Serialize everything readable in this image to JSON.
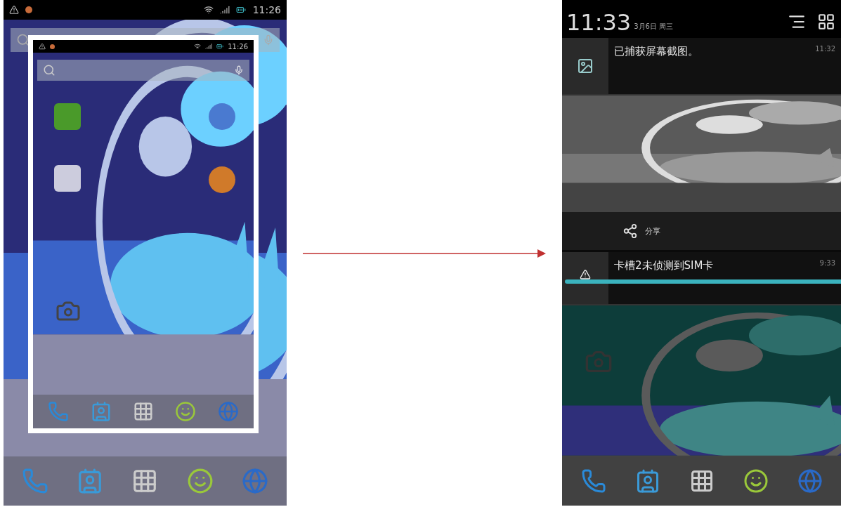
{
  "left_screen": {
    "status_time": "11:26",
    "screenshot_preview": {
      "status_time": "11:26"
    }
  },
  "right_screen": {
    "header": {
      "time": "11:33",
      "date": "3月6日 周三"
    },
    "notifications": [
      {
        "kind": "screenshot",
        "title": "已捕获屏幕截图。",
        "time": "11:32",
        "action": "分享"
      },
      {
        "kind": "warning",
        "title": "卡槽2未侦测到SIM卡",
        "time": "9:33",
        "level": 1
      }
    ]
  }
}
